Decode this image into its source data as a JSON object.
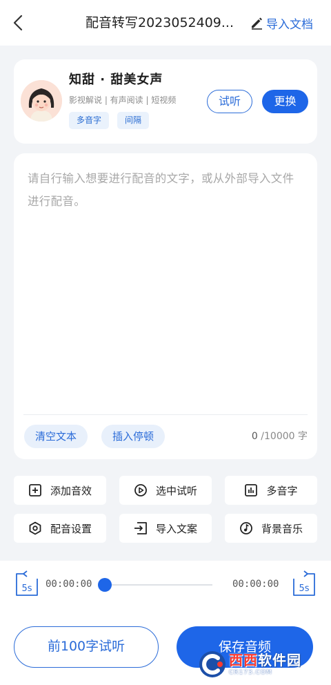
{
  "header": {
    "title": "配音转写2023052409...",
    "import_doc_label": "导入文档"
  },
  "voice": {
    "name": "知甜 · 甜美女声",
    "categories": "影视解说 | 有声阅读 | 短视频",
    "chips": [
      "多音字",
      "间隔"
    ],
    "listen_label": "试听",
    "change_label": "更换"
  },
  "editor": {
    "placeholder": "请自行输入想要进行配音的文字，或从外部导入文件进行配音。",
    "clear_label": "清空文本",
    "insert_pause_label": "插入停顿",
    "count_current": "0",
    "count_max": " /10000 字"
  },
  "tools": [
    {
      "label": "添加音效",
      "icon": "plus-square-icon"
    },
    {
      "label": "选中试听",
      "icon": "play-circle-icon"
    },
    {
      "label": "多音字",
      "icon": "bar-chart-icon"
    },
    {
      "label": "配音设置",
      "icon": "settings-icon"
    },
    {
      "label": "导入文案",
      "icon": "import-icon"
    },
    {
      "label": "背景音乐",
      "icon": "music-note-icon"
    }
  ],
  "player": {
    "skip_back_label": "5s",
    "skip_forward_label": "5s",
    "current_time": "00:00:00",
    "total_time": "00:00:00",
    "progress": 0
  },
  "actions": {
    "preview_label": "前100字试听",
    "save_label": "保存音频"
  },
  "watermark": {
    "text_red": "西西",
    "text_white": "软件园",
    "sub": "CR173.COM"
  },
  "colors": {
    "accent": "#1e66e8",
    "background": "#f2f4f7",
    "chip_bg": "#eaf2fc"
  }
}
